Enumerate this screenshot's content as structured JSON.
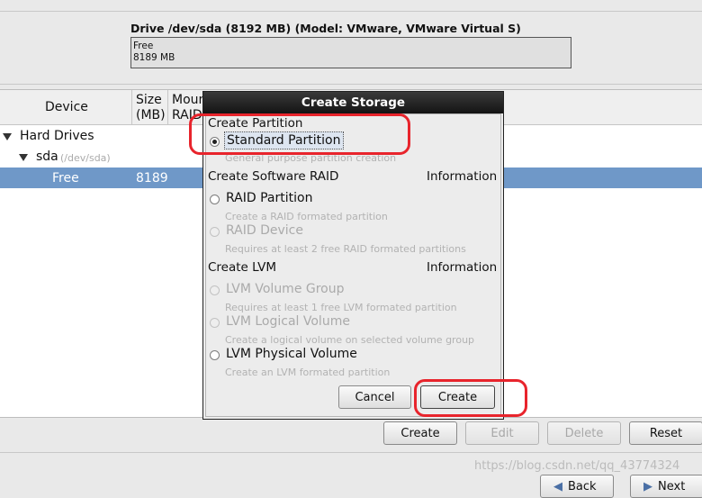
{
  "drive": {
    "title": "Drive /dev/sda (8192 MB) (Model: VMware, VMware Virtual S)",
    "bar_label": "Free",
    "bar_size": "8189 MB"
  },
  "table": {
    "headers": {
      "device": "Device",
      "size_line1": "Size",
      "size_line2": "(MB)",
      "mount_line1": "Moun",
      "mount_line2": "RAID"
    },
    "rows": {
      "hard_drives": "Hard Drives",
      "sda_name": "sda",
      "sda_path": "(/dev/sda)",
      "free_device": "Free",
      "free_size": "8189"
    }
  },
  "toolbar": {
    "create": "Create",
    "edit": "Edit",
    "delete": "Delete",
    "reset": "Reset"
  },
  "nav": {
    "back": "Back",
    "next": "Next"
  },
  "dialog": {
    "title": "Create Storage",
    "section_partition": "Create Partition",
    "standard_partition": "Standard Partition",
    "standard_partition_desc": "General purpose partition creation",
    "section_raid": "Create Software RAID",
    "raid_info": "Information",
    "raid_partition": "RAID Partition",
    "raid_partition_desc": "Create a RAID formated partition",
    "raid_device": "RAID Device",
    "raid_device_desc": "Requires at least 2 free RAID formated partitions",
    "section_lvm": "Create LVM",
    "lvm_info": "Information",
    "lvm_vg": "LVM Volume Group",
    "lvm_vg_desc": "Requires at least 1 free LVM formated partition",
    "lvm_lv": "LVM Logical Volume",
    "lvm_lv_desc": "Create a logical volume on selected volume group",
    "lvm_pv": "LVM Physical Volume",
    "lvm_pv_desc": "Create an LVM formated partition",
    "cancel": "Cancel",
    "create": "Create"
  },
  "watermark": "https://blog.csdn.net/qq_43774324",
  "colors": {
    "selection": "#6f98c8",
    "highlight": "#e8242c",
    "dialog_title_bg": "#1c1c1c"
  }
}
